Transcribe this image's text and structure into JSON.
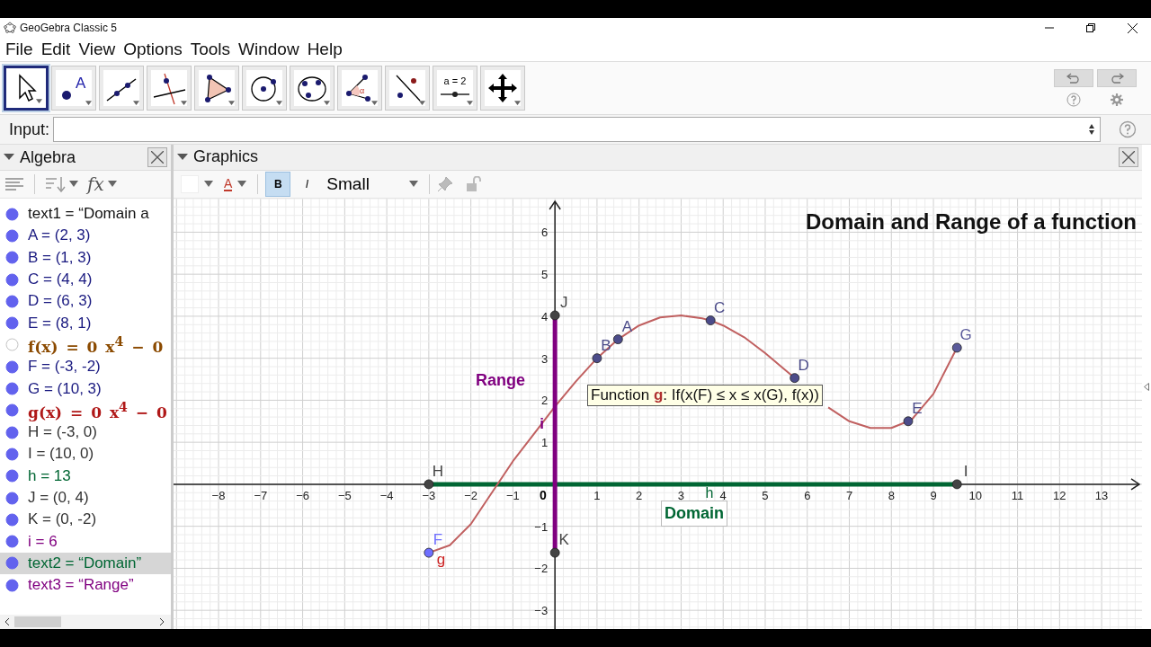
{
  "window": {
    "title": "GeoGebra Classic 5"
  },
  "menu": [
    "File",
    "Edit",
    "View",
    "Options",
    "Tools",
    "Window",
    "Help"
  ],
  "toolbar": {
    "tools": [
      {
        "kind": "move",
        "selected": true
      },
      {
        "kind": "point",
        "label": "A",
        "selected": false
      },
      {
        "kind": "line",
        "selected": false
      },
      {
        "kind": "perpendicular",
        "selected": false
      },
      {
        "kind": "polygon",
        "selected": false
      },
      {
        "kind": "circle",
        "selected": false
      },
      {
        "kind": "conic",
        "selected": false
      },
      {
        "kind": "angle",
        "label": "α",
        "selected": false
      },
      {
        "kind": "reflect",
        "selected": false
      },
      {
        "kind": "slider",
        "label": "a = 2",
        "selected": false
      },
      {
        "kind": "move-view",
        "selected": false
      }
    ]
  },
  "input_bar": {
    "label": "Input:"
  },
  "algebra": {
    "title": "Algebra",
    "fx": "fx",
    "items": [
      {
        "text": "text1 = “Domain a",
        "color": "#111111",
        "kind": "plain",
        "visible": true,
        "selected": false
      },
      {
        "text": "A = (2, 3)",
        "color": "#1a1a80",
        "kind": "plain",
        "visible": true,
        "selected": false
      },
      {
        "text": "B = (1, 3)",
        "color": "#1a1a80",
        "kind": "plain",
        "visible": true,
        "selected": false
      },
      {
        "text": "C = (4, 4)",
        "color": "#1a1a80",
        "kind": "plain",
        "visible": true,
        "selected": false
      },
      {
        "text": "D = (6, 3)",
        "color": "#1a1a80",
        "kind": "plain",
        "visible": true,
        "selected": false
      },
      {
        "text": "E = (8, 1)",
        "color": "#1a1a80",
        "kind": "plain",
        "visible": true,
        "selected": false
      },
      {
        "text": "f(x) = 0 x$^{4}$ − 0",
        "color": "#8b4a00",
        "kind": "formula",
        "visible": false,
        "selected": false
      },
      {
        "text": "F = (-3, -2)",
        "color": "#1a1a80",
        "kind": "plain",
        "visible": true,
        "selected": false
      },
      {
        "text": "G = (10, 3)",
        "color": "#1a1a80",
        "kind": "plain",
        "visible": true,
        "selected": false
      },
      {
        "text": "g(x) = 0 x$^{4}$ − 0",
        "color": "#b01818",
        "kind": "formula",
        "visible": true,
        "selected": false
      },
      {
        "text": "H = (-3, 0)",
        "color": "#333333",
        "kind": "plain",
        "visible": true,
        "selected": false
      },
      {
        "text": "I = (10, 0)",
        "color": "#333333",
        "kind": "plain",
        "visible": true,
        "selected": false
      },
      {
        "text": "h = 13",
        "color": "#006633",
        "kind": "plain",
        "visible": true,
        "selected": false
      },
      {
        "text": "J = (0, 4)",
        "color": "#333333",
        "kind": "plain",
        "visible": true,
        "selected": false
      },
      {
        "text": "K = (0, -2)",
        "color": "#333333",
        "kind": "plain",
        "visible": true,
        "selected": false
      },
      {
        "text": "i = 6",
        "color": "#800080",
        "kind": "plain",
        "visible": true,
        "selected": false
      },
      {
        "text": "text2 = “Domain”",
        "color": "#006633",
        "kind": "plain",
        "visible": true,
        "selected": true
      },
      {
        "text": "text3 = “Range”",
        "color": "#800080",
        "kind": "plain",
        "visible": true,
        "selected": false
      }
    ]
  },
  "graphics": {
    "title": "Graphics",
    "style_bar": {
      "text_color_label": "A",
      "bold": {
        "label": "B",
        "selected": true
      },
      "italic": {
        "label": "I",
        "selected": false
      },
      "size": "Small"
    },
    "tooltip": "Function **g**: If(x(F) ≤ x ≤ x(G), f(x))",
    "texts": [
      {
        "kind": "title",
        "text": "Domain and Range of a function",
        "color": "#111111"
      },
      {
        "kind": "caption",
        "text": "Range",
        "color": "#800080"
      },
      {
        "kind": "boxed",
        "text": "Domain",
        "color": "#006633"
      },
      {
        "kind": "origin",
        "text": "0",
        "color": "#000000"
      }
    ],
    "chart_data": {
      "type": "line",
      "grid": true,
      "xlim": [
        -9.07,
        13.96
      ],
      "ylim": [
        -3.51,
        6.8
      ],
      "xticks": [
        {
          "value": -8,
          "label": "−8"
        },
        {
          "value": -7,
          "label": "−7"
        },
        {
          "value": -6,
          "label": "−6"
        },
        {
          "value": -5,
          "label": "−5"
        },
        {
          "value": -4,
          "label": "−4"
        },
        {
          "value": -3,
          "label": "−3"
        },
        {
          "value": -2,
          "label": "−2"
        },
        {
          "value": -1,
          "label": "−1"
        },
        1,
        2,
        3,
        4,
        5,
        6,
        7,
        8,
        9,
        10,
        11,
        12,
        13
      ],
      "yticks": [
        {
          "value": -3,
          "label": "−3"
        },
        {
          "value": -2,
          "label": "−2"
        },
        {
          "value": -1,
          "label": "−1"
        },
        1,
        2,
        3,
        4,
        5,
        6
      ],
      "x": [
        -3,
        -2.5,
        -2,
        -1.5,
        -1,
        -0.5,
        0,
        0.5,
        1,
        1.5,
        2,
        2.5,
        3,
        3.5,
        3.7,
        4,
        4.5,
        5,
        5.5,
        5.7,
        6,
        6.5,
        7,
        7.5,
        8,
        8.4,
        8.5,
        9,
        9.56
      ],
      "ref_lines": [
        {
          "axis": "x",
          "value": 0,
          "color": "#800080",
          "label": "i"
        }
      ],
      "series": [
        {
          "name": "h",
          "color": "#006633",
          "values": [
            0,
            0,
            0,
            0,
            0,
            0,
            0,
            0,
            0,
            0,
            0,
            0,
            0,
            0,
            0,
            0,
            0,
            0,
            0,
            0,
            0,
            0,
            0,
            0,
            0,
            0,
            0,
            0,
            0
          ]
        },
        {
          "name": "g",
          "color": "#c06060",
          "values": [
            -1.63,
            -1.45,
            -0.95,
            -0.2,
            0.55,
            1.2,
            1.85,
            2.45,
            3.0,
            3.45,
            3.78,
            3.97,
            4.02,
            3.95,
            3.9,
            3.78,
            3.5,
            3.12,
            2.7,
            2.53,
            null,
            1.83,
            1.5,
            1.34,
            1.34,
            1.5,
            1.56,
            2.15,
            3.25
          ]
        },
        {
          "name": "F",
          "marker": true,
          "color": "#6f6fff",
          "values": [
            -1.63,
            null,
            null,
            null,
            null,
            null,
            null,
            null,
            null,
            null,
            null,
            null,
            null,
            null,
            null,
            null,
            null,
            null,
            null,
            null,
            null,
            null,
            null,
            null,
            null,
            null,
            null,
            null,
            null
          ]
        },
        {
          "name": "B",
          "marker": true,
          "color": "#4c4c8a",
          "values": [
            null,
            null,
            null,
            null,
            null,
            null,
            null,
            null,
            3.0,
            null,
            null,
            null,
            null,
            null,
            null,
            null,
            null,
            null,
            null,
            null,
            null,
            null,
            null,
            null,
            null,
            null,
            null,
            null,
            null
          ]
        },
        {
          "name": "A",
          "marker": true,
          "color": "#4c4c8a",
          "values": [
            null,
            null,
            null,
            null,
            null,
            null,
            null,
            null,
            null,
            3.45,
            null,
            null,
            null,
            null,
            null,
            null,
            null,
            null,
            null,
            null,
            null,
            null,
            null,
            null,
            null,
            null,
            null,
            null,
            null
          ]
        },
        {
          "name": "C",
          "marker": true,
          "color": "#4c4c8a",
          "values": [
            null,
            null,
            null,
            null,
            null,
            null,
            null,
            null,
            null,
            null,
            null,
            null,
            null,
            null,
            3.9,
            null,
            null,
            null,
            null,
            null,
            null,
            null,
            null,
            null,
            null,
            null,
            null,
            null,
            null
          ]
        },
        {
          "name": "D",
          "marker": true,
          "color": "#4c4c8a",
          "values": [
            null,
            null,
            null,
            null,
            null,
            null,
            null,
            null,
            null,
            null,
            null,
            null,
            null,
            null,
            null,
            null,
            null,
            null,
            null,
            2.53,
            null,
            null,
            null,
            null,
            null,
            null,
            null,
            null,
            null
          ]
        },
        {
          "name": "E",
          "marker": true,
          "color": "#4c4c8a",
          "values": [
            null,
            null,
            null,
            null,
            null,
            null,
            null,
            null,
            null,
            null,
            null,
            null,
            null,
            null,
            null,
            null,
            null,
            null,
            null,
            null,
            null,
            null,
            null,
            null,
            null,
            1.5,
            null,
            null,
            null
          ]
        },
        {
          "name": "G",
          "marker": true,
          "color": "#5a5a9a",
          "values": [
            null,
            null,
            null,
            null,
            null,
            null,
            null,
            null,
            null,
            null,
            null,
            null,
            null,
            null,
            null,
            null,
            null,
            null,
            null,
            null,
            null,
            null,
            null,
            null,
            null,
            null,
            null,
            null,
            3.25
          ]
        },
        {
          "name": "H",
          "marker": true,
          "color": "#444444",
          "values": [
            0,
            null,
            null,
            null,
            null,
            null,
            null,
            null,
            null,
            null,
            null,
            null,
            null,
            null,
            null,
            null,
            null,
            null,
            null,
            null,
            null,
            null,
            null,
            null,
            null,
            null,
            null,
            null,
            null
          ]
        },
        {
          "name": "I",
          "marker": true,
          "color": "#444444",
          "values": [
            null,
            null,
            null,
            null,
            null,
            null,
            null,
            null,
            null,
            null,
            null,
            null,
            null,
            null,
            null,
            null,
            null,
            null,
            null,
            null,
            null,
            null,
            null,
            null,
            null,
            null,
            null,
            null,
            0
          ]
        },
        {
          "name": "J",
          "marker": true,
          "color": "#444444",
          "values": [
            null,
            null,
            null,
            null,
            null,
            null,
            4.02,
            null,
            null,
            null,
            null,
            null,
            null,
            null,
            null,
            null,
            null,
            null,
            null,
            null,
            null,
            null,
            null,
            null,
            null,
            null,
            null,
            null,
            null
          ]
        },
        {
          "name": "K",
          "marker": true,
          "color": "#444444",
          "values": [
            null,
            null,
            null,
            null,
            null,
            null,
            -1.63,
            null,
            null,
            null,
            null,
            null,
            null,
            null,
            null,
            null,
            null,
            null,
            null,
            null,
            null,
            null,
            null,
            null,
            null,
            null,
            null,
            null,
            null
          ]
        }
      ]
    }
  }
}
